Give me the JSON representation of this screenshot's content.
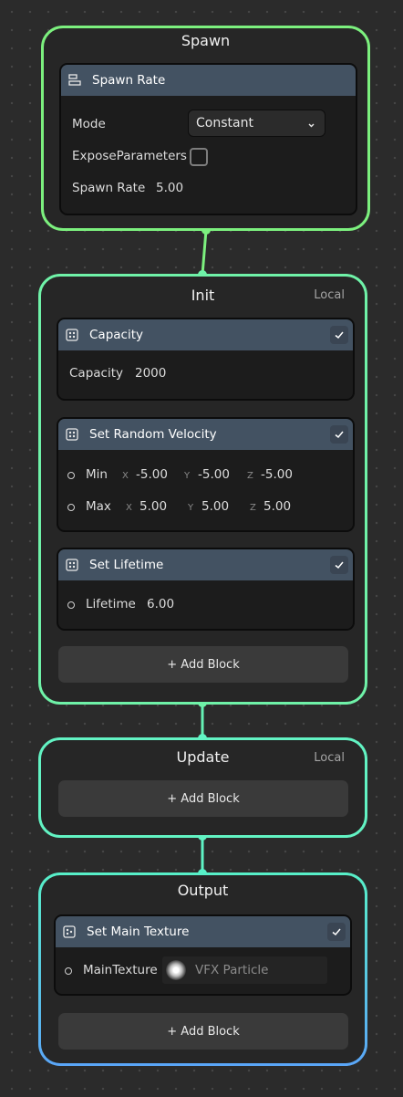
{
  "colors": {
    "spawn_border": "#7cf07e",
    "init_border": "#6ff2a8",
    "update_border": "#62f3c3",
    "output_border_top": "#57f0c8",
    "output_border_bottom": "#5aa6f8",
    "block_header": "#435262",
    "canvas_bg": "#2b2b2b"
  },
  "spawn": {
    "title": "Spawn",
    "block": {
      "title": "Spawn Rate",
      "icon": "spawn-rate-icon",
      "mode_label": "Mode",
      "mode_value": "Constant",
      "expose_label": "ExposeParameters",
      "expose_checked": false,
      "rate_label": "Spawn Rate",
      "rate_value": "5.00"
    }
  },
  "init": {
    "title": "Init",
    "space": "Local",
    "blocks": {
      "capacity": {
        "title": "Capacity",
        "label": "Capacity",
        "value": "2000",
        "enabled": true
      },
      "velocity": {
        "title": "Set Random Velocity",
        "enabled": true,
        "min_label": "Min",
        "max_label": "Max",
        "x_label": "X",
        "y_label": "Y",
        "z_label": "Z",
        "min": {
          "x": "-5.00",
          "y": "-5.00",
          "z": "-5.00"
        },
        "max": {
          "x": "5.00",
          "y": "5.00",
          "z": "5.00"
        }
      },
      "lifetime": {
        "title": "Set Lifetime",
        "label": "Lifetime",
        "value": "6.00",
        "enabled": true
      }
    },
    "add_block": "+ Add Block"
  },
  "update": {
    "title": "Update",
    "space": "Local",
    "add_block": "+ Add Block"
  },
  "output": {
    "title": "Output",
    "block": {
      "title": "Set Main Texture",
      "label": "MainTexture",
      "texture": "VFX Particle",
      "enabled": true
    },
    "add_block": "+ Add Block"
  }
}
